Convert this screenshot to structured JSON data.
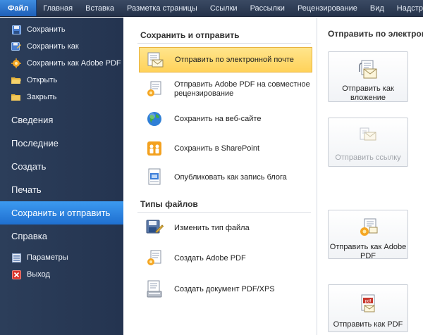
{
  "ribbon": {
    "tabs": [
      "Файл",
      "Главная",
      "Вставка",
      "Разметка страницы",
      "Ссылки",
      "Рассылки",
      "Рецензирование",
      "Вид",
      "Надстр"
    ]
  },
  "nav": {
    "commands_top": [
      {
        "label": "Сохранить",
        "icon": "save-icon"
      },
      {
        "label": "Сохранить как",
        "icon": "save-as-icon"
      },
      {
        "label": "Сохранить как Adobe PDF",
        "icon": "pdf-icon"
      },
      {
        "label": "Открыть",
        "icon": "open-folder-icon"
      },
      {
        "label": "Закрыть",
        "icon": "close-folder-icon"
      }
    ],
    "tabs": [
      "Сведения",
      "Последние",
      "Создать",
      "Печать",
      "Сохранить и отправить",
      "Справка"
    ],
    "active_tab": "Сохранить и отправить",
    "commands_bottom": [
      {
        "label": "Параметры",
        "icon": "options-icon"
      },
      {
        "label": "Выход",
        "icon": "exit-icon"
      }
    ]
  },
  "middle": {
    "section1_title": "Сохранить и отправить",
    "section1_items": [
      {
        "label": "Отправить по электронной почте",
        "icon": "email-icon"
      },
      {
        "label": "Отправить Adobe PDF на совместное рецензирование",
        "icon": "pdf-review-icon"
      },
      {
        "label": "Сохранить на веб-сайте",
        "icon": "globe-icon"
      },
      {
        "label": "Сохранить в SharePoint",
        "icon": "sharepoint-icon"
      },
      {
        "label": "Опубликовать как запись блога",
        "icon": "blog-icon"
      }
    ],
    "section2_title": "Типы файлов",
    "section2_items": [
      {
        "label": "Изменить тип файла",
        "icon": "change-type-icon"
      },
      {
        "label": "Создать Adobe PDF",
        "icon": "create-pdf-icon"
      },
      {
        "label": "Создать документ PDF/XPS",
        "icon": "pdf-xps-icon"
      }
    ]
  },
  "right": {
    "title": "Отправить по электронной",
    "buttons": [
      {
        "label": "Отправить как вложение",
        "icon": "attachment-icon",
        "enabled": true
      },
      {
        "label": "Отправить ссылку",
        "icon": "send-link-icon",
        "enabled": false
      },
      {
        "label": "Отправить как Adobe PDF",
        "icon": "send-adobe-pdf-icon",
        "enabled": true
      },
      {
        "label": "Отправить как PDF",
        "icon": "send-pdf-icon",
        "enabled": true
      }
    ]
  },
  "colors": {
    "nav_bg": "#2c3e5a",
    "nav_active": "#2a86e6",
    "item_highlight": "#ffd860",
    "tab_file": "#2a74d0"
  }
}
